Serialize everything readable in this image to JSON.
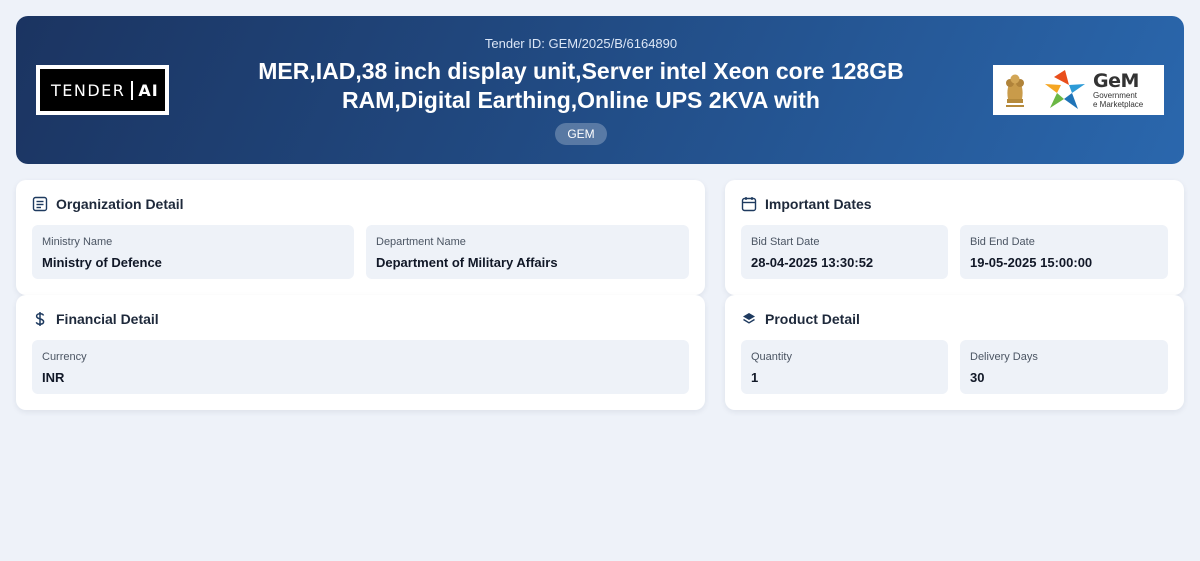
{
  "header": {
    "brand_logo": {
      "text": "TENDER",
      "box_text": "AI"
    },
    "tender_id": "Tender ID: GEM/2025/B/6164890",
    "title": "MER,IAD,38 inch display unit,Server intel Xeon core 128GB RAM,Digital Earthing,Online UPS 2KVA with",
    "source_badge": "GEM",
    "gem_logo": {
      "name": "GeM",
      "line1": "Government",
      "line2": "e Marketplace"
    }
  },
  "organization": {
    "title": "Organization Detail",
    "icon": "document-list-icon",
    "fields": [
      {
        "label": "Ministry Name",
        "value": "Ministry of Defence"
      },
      {
        "label": "Department Name",
        "value": "Department of Military Affairs"
      }
    ]
  },
  "dates": {
    "title": "Important Dates",
    "icon": "calendar-icon",
    "fields": [
      {
        "label": "Bid Start Date",
        "value": "28-04-2025 13:30:52"
      },
      {
        "label": "Bid End Date",
        "value": "19-05-2025 15:00:00"
      }
    ]
  },
  "financial": {
    "title": "Financial Detail",
    "icon": "dollar-icon",
    "fields": [
      {
        "label": "Currency",
        "value": "INR"
      }
    ]
  },
  "product": {
    "title": "Product Detail",
    "icon": "layers-icon",
    "fields": [
      {
        "label": "Quantity",
        "value": "1"
      },
      {
        "label": "Delivery Days",
        "value": "30"
      }
    ]
  },
  "colors": {
    "header_gradient_start": "#1b3461",
    "header_gradient_end": "#2a67ad",
    "page_background": "#eef2f9",
    "field_background": "#eef2f8"
  }
}
